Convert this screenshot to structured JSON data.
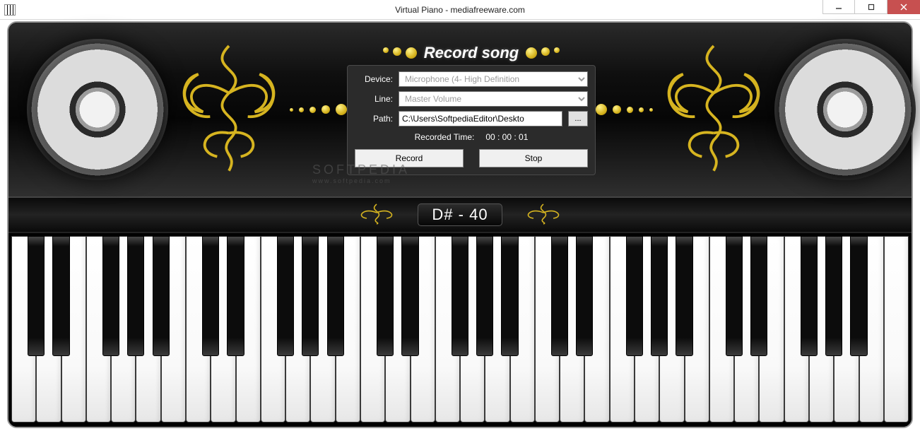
{
  "window": {
    "title": "Virtual Piano - mediafreeware.com"
  },
  "record_panel": {
    "heading": "Record song",
    "device_label": "Device:",
    "device_value": "Microphone (4- High Definition",
    "line_label": "Line:",
    "line_value": "Master Volume",
    "path_label": "Path:",
    "path_value": "C:\\Users\\SoftpediaEditor\\Deskto",
    "browse_label": "...",
    "recorded_time_label": "Recorded Time:",
    "recorded_time_value": "00 : 00 : 01",
    "record_button": "Record",
    "stop_button": "Stop"
  },
  "note_display": {
    "value": "D#  -  40"
  },
  "watermark": {
    "brand": "SOFTPEDIA",
    "url": "www.softpedia.com"
  },
  "keyboard": {
    "white_key_count": 36,
    "black_key_pattern": "5-octave-subset"
  }
}
